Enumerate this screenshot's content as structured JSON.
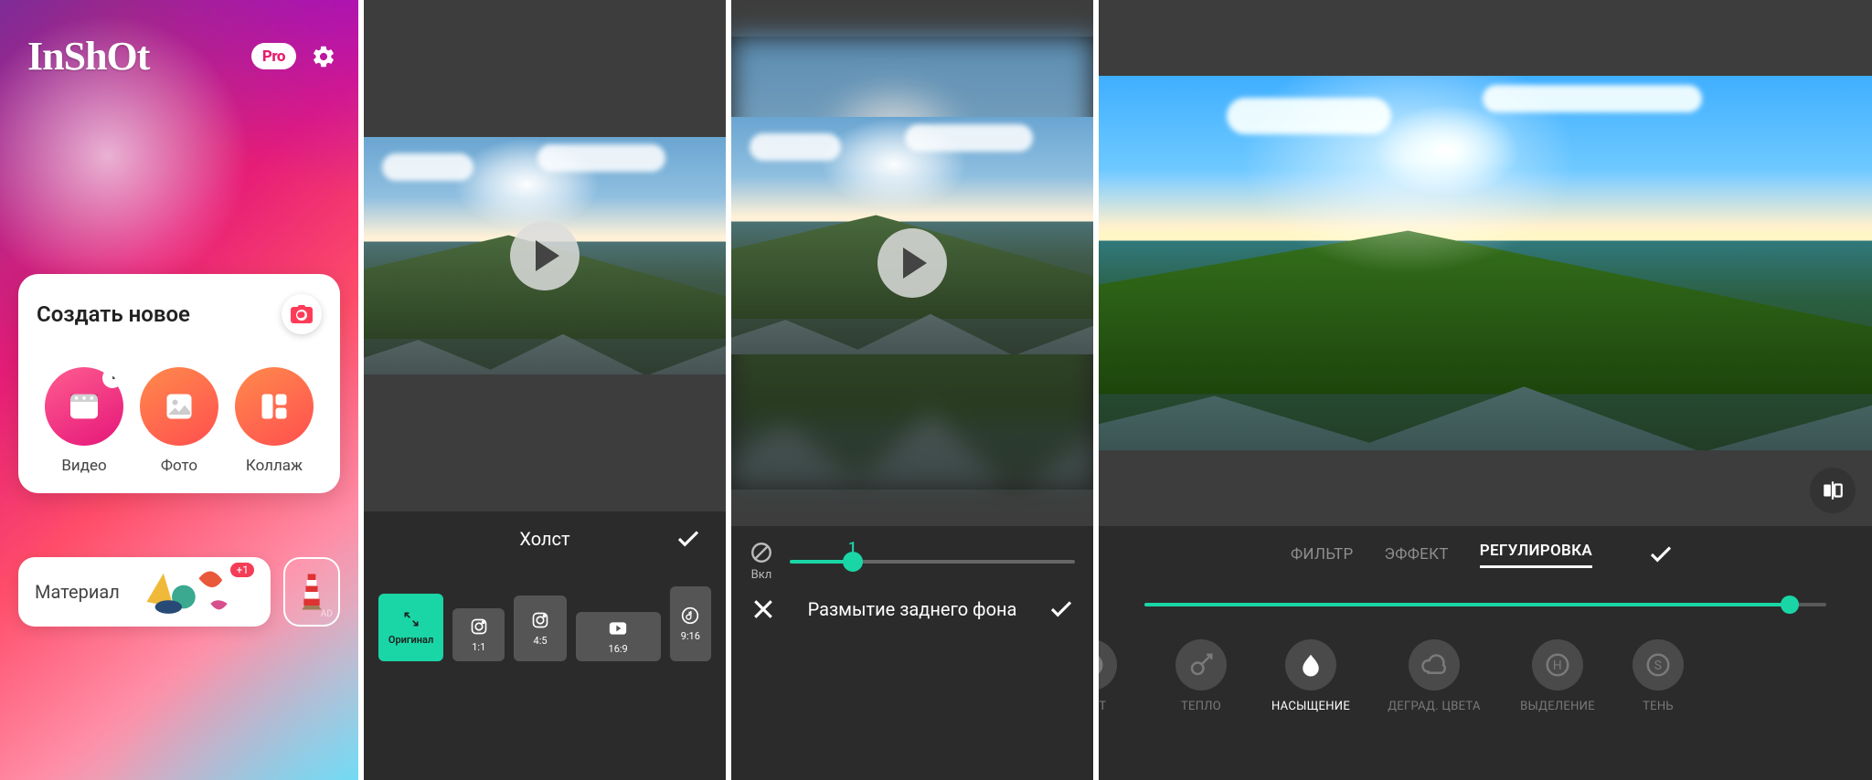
{
  "home": {
    "logo": "InShOt",
    "pro_label": "Pro",
    "create_title": "Создать новое",
    "items": [
      {
        "label": "Видео"
      },
      {
        "label": "Фото"
      },
      {
        "label": "Коллаж"
      }
    ],
    "material_label": "Материал",
    "material_badge": "+1",
    "ad_label": "AD"
  },
  "canvas_panel": {
    "title": "Холст",
    "ratios": [
      {
        "label": "Оригинал",
        "sub": ""
      },
      {
        "label": "1:1",
        "sub": ""
      },
      {
        "label": "4:5",
        "sub": ""
      },
      {
        "label": "16:9",
        "sub": ""
      },
      {
        "label": "9:16",
        "sub": ""
      }
    ]
  },
  "blur_panel": {
    "enable_label": "Вкл",
    "slider_value": "1",
    "title": "Размытие заднего фона"
  },
  "adjust_panel": {
    "tabs": [
      {
        "label": "ФИЛЬТР"
      },
      {
        "label": "ЭФФЕКТ"
      },
      {
        "label": "РЕГУЛИРОВКА"
      }
    ],
    "active_tab_index": 2,
    "items": [
      {
        "label": "РАСТ"
      },
      {
        "label": "ТЕПЛО"
      },
      {
        "label": "НАСЫЩЕНИЕ"
      },
      {
        "label": "ДЕГРАД. ЦВЕТА"
      },
      {
        "label": "ВЫДЕЛЕНИЕ"
      },
      {
        "label": "ТЕНЬ"
      }
    ],
    "active_item_index": 2
  }
}
